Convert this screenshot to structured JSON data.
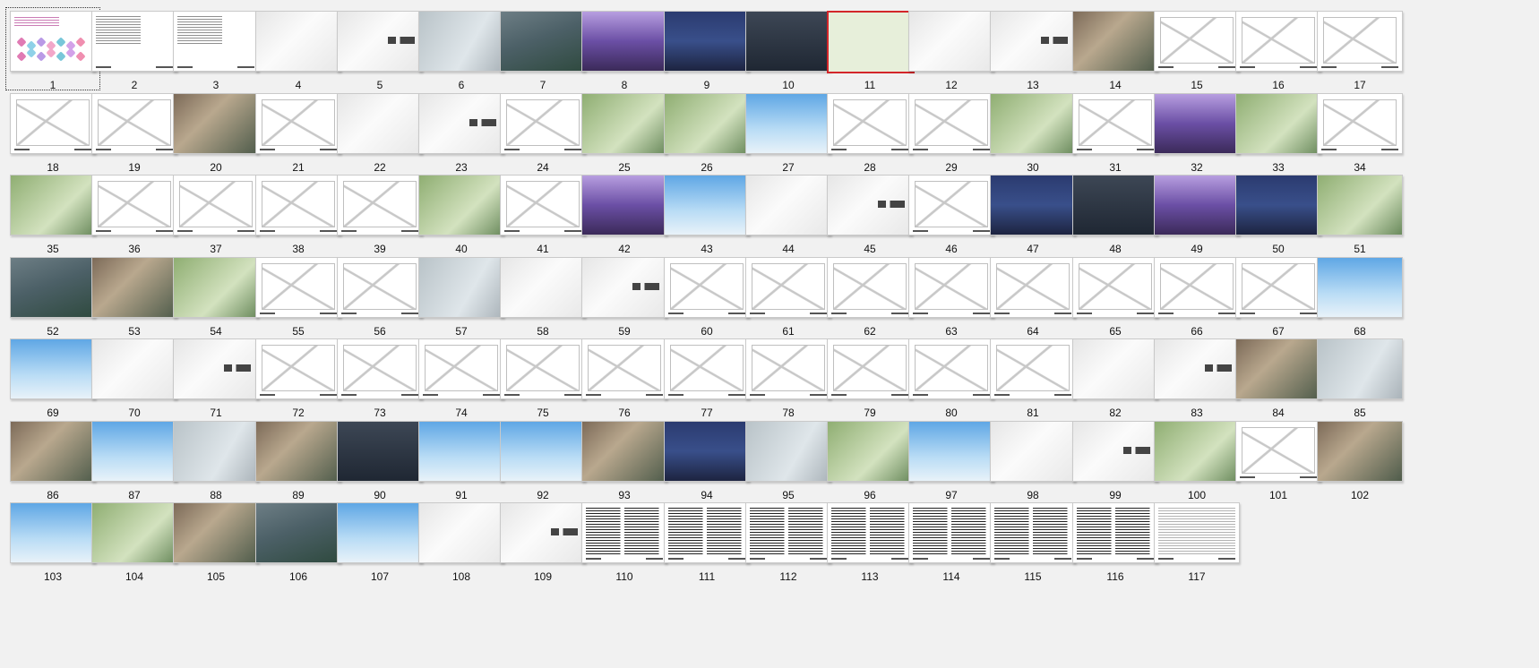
{
  "view": {
    "selected_slide": 11,
    "focused_slide": 1
  },
  "slides": [
    {
      "n": "1",
      "type": "cover"
    },
    {
      "n": "2",
      "type": "toc"
    },
    {
      "n": "3",
      "type": "toc"
    },
    {
      "n": "4",
      "type": "blank"
    },
    {
      "n": "5",
      "type": "chapter"
    },
    {
      "n": "6",
      "type": "t-gray"
    },
    {
      "n": "7",
      "type": "t-aerial"
    },
    {
      "n": "8",
      "type": "t-purple"
    },
    {
      "n": "9",
      "type": "t-night"
    },
    {
      "n": "10",
      "type": "t-dark"
    },
    {
      "n": "11",
      "type": "t-map"
    },
    {
      "n": "12",
      "type": "blank"
    },
    {
      "n": "13",
      "type": "chapter"
    },
    {
      "n": "14",
      "type": "t-photo"
    },
    {
      "n": "15",
      "type": "plan"
    },
    {
      "n": "16",
      "type": "plan"
    },
    {
      "n": "17",
      "type": "plan"
    },
    {
      "n": "18",
      "type": "plan"
    },
    {
      "n": "19",
      "type": "plan"
    },
    {
      "n": "20",
      "type": "t-photo"
    },
    {
      "n": "21",
      "type": "plan"
    },
    {
      "n": "22",
      "type": "blank"
    },
    {
      "n": "23",
      "type": "chapter"
    },
    {
      "n": "24",
      "type": "plan"
    },
    {
      "n": "25",
      "type": "t-green"
    },
    {
      "n": "26",
      "type": "t-green"
    },
    {
      "n": "27",
      "type": "t-sky"
    },
    {
      "n": "28",
      "type": "plan"
    },
    {
      "n": "29",
      "type": "plan"
    },
    {
      "n": "30",
      "type": "t-green"
    },
    {
      "n": "31",
      "type": "plan"
    },
    {
      "n": "32",
      "type": "t-purple"
    },
    {
      "n": "33",
      "type": "t-green"
    },
    {
      "n": "34",
      "type": "plan"
    },
    {
      "n": "35",
      "type": "t-green"
    },
    {
      "n": "36",
      "type": "plan"
    },
    {
      "n": "37",
      "type": "plan"
    },
    {
      "n": "38",
      "type": "plan"
    },
    {
      "n": "39",
      "type": "plan"
    },
    {
      "n": "40",
      "type": "t-green"
    },
    {
      "n": "41",
      "type": "plan"
    },
    {
      "n": "42",
      "type": "t-purple"
    },
    {
      "n": "43",
      "type": "t-sky"
    },
    {
      "n": "44",
      "type": "blank"
    },
    {
      "n": "45",
      "type": "chapter"
    },
    {
      "n": "46",
      "type": "plan"
    },
    {
      "n": "47",
      "type": "t-night"
    },
    {
      "n": "48",
      "type": "t-dark"
    },
    {
      "n": "49",
      "type": "t-purple"
    },
    {
      "n": "50",
      "type": "t-night"
    },
    {
      "n": "51",
      "type": "t-green"
    },
    {
      "n": "52",
      "type": "t-aerial"
    },
    {
      "n": "53",
      "type": "t-photo"
    },
    {
      "n": "54",
      "type": "t-green"
    },
    {
      "n": "55",
      "type": "plan"
    },
    {
      "n": "56",
      "type": "plan"
    },
    {
      "n": "57",
      "type": "t-gray"
    },
    {
      "n": "58",
      "type": "blank"
    },
    {
      "n": "59",
      "type": "chapter"
    },
    {
      "n": "60",
      "type": "plan"
    },
    {
      "n": "61",
      "type": "plan"
    },
    {
      "n": "62",
      "type": "plan"
    },
    {
      "n": "63",
      "type": "plan"
    },
    {
      "n": "64",
      "type": "plan"
    },
    {
      "n": "65",
      "type": "plan"
    },
    {
      "n": "66",
      "type": "plan"
    },
    {
      "n": "67",
      "type": "plan"
    },
    {
      "n": "68",
      "type": "t-sky"
    },
    {
      "n": "69",
      "type": "t-sky"
    },
    {
      "n": "70",
      "type": "blank"
    },
    {
      "n": "71",
      "type": "chapter"
    },
    {
      "n": "72",
      "type": "plan"
    },
    {
      "n": "73",
      "type": "plan"
    },
    {
      "n": "74",
      "type": "plan"
    },
    {
      "n": "75",
      "type": "plan"
    },
    {
      "n": "76",
      "type": "plan"
    },
    {
      "n": "77",
      "type": "plan"
    },
    {
      "n": "78",
      "type": "plan"
    },
    {
      "n": "79",
      "type": "plan"
    },
    {
      "n": "80",
      "type": "plan"
    },
    {
      "n": "81",
      "type": "plan"
    },
    {
      "n": "82",
      "type": "blank"
    },
    {
      "n": "83",
      "type": "chapter"
    },
    {
      "n": "84",
      "type": "t-photo"
    },
    {
      "n": "85",
      "type": "t-gray"
    },
    {
      "n": "86",
      "type": "t-photo"
    },
    {
      "n": "87",
      "type": "t-sky"
    },
    {
      "n": "88",
      "type": "t-gray"
    },
    {
      "n": "89",
      "type": "t-photo"
    },
    {
      "n": "90",
      "type": "t-dark"
    },
    {
      "n": "91",
      "type": "t-sky"
    },
    {
      "n": "92",
      "type": "t-sky"
    },
    {
      "n": "93",
      "type": "t-photo"
    },
    {
      "n": "94",
      "type": "t-night"
    },
    {
      "n": "95",
      "type": "t-gray"
    },
    {
      "n": "96",
      "type": "t-green"
    },
    {
      "n": "97",
      "type": "t-sky"
    },
    {
      "n": "98",
      "type": "blank"
    },
    {
      "n": "99",
      "type": "chapter"
    },
    {
      "n": "100",
      "type": "t-green"
    },
    {
      "n": "101",
      "type": "plan"
    },
    {
      "n": "102",
      "type": "t-photo"
    },
    {
      "n": "103",
      "type": "t-sky"
    },
    {
      "n": "104",
      "type": "t-green"
    },
    {
      "n": "105",
      "type": "t-photo"
    },
    {
      "n": "106",
      "type": "t-aerial"
    },
    {
      "n": "107",
      "type": "t-sky"
    },
    {
      "n": "108",
      "type": "blank"
    },
    {
      "n": "109",
      "type": "chapter"
    },
    {
      "n": "110",
      "type": "text"
    },
    {
      "n": "111",
      "type": "text"
    },
    {
      "n": "112",
      "type": "text"
    },
    {
      "n": "113",
      "type": "text"
    },
    {
      "n": "114",
      "type": "text"
    },
    {
      "n": "115",
      "type": "text"
    },
    {
      "n": "116",
      "type": "text"
    },
    {
      "n": "117",
      "type": "table"
    }
  ],
  "colors": {
    "selection_border": "#d3262a",
    "background": "#f1f1f1"
  }
}
